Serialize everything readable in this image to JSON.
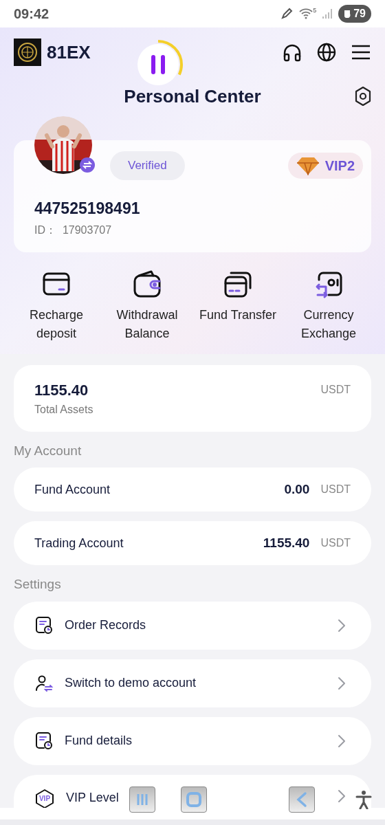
{
  "status_bar": {
    "time": "09:42",
    "wifi_badge": "5",
    "battery": "79"
  },
  "header": {
    "brand": "81EX",
    "title": "Personal Center"
  },
  "media_overlay": {
    "playing": true,
    "level": 0.32
  },
  "profile": {
    "verified": "Verified",
    "vip": "VIP2",
    "username": "447525198491",
    "id": "ID：  17903707"
  },
  "actions": [
    {
      "kind": "recharge",
      "label": "Recharge deposit"
    },
    {
      "kind": "withdraw",
      "label": "Withdrawal Balance"
    },
    {
      "kind": "transfer",
      "label": "Fund Transfer"
    },
    {
      "kind": "exchange",
      "label": "Currency Exchange"
    }
  ],
  "total_assets": {
    "amount": "1155.40",
    "label": "Total Assets",
    "unit": "USDT"
  },
  "my_account": {
    "title": "My Account",
    "rows": [
      {
        "name": "Fund Account",
        "amount": "0.00",
        "unit": "USDT"
      },
      {
        "name": "Trading Account",
        "amount": "1155.40",
        "unit": "USDT"
      }
    ]
  },
  "settings": {
    "title": "Settings",
    "items": [
      {
        "kind": "records",
        "label": "Order Records"
      },
      {
        "kind": "switch",
        "label": "Switch to demo account"
      },
      {
        "kind": "records",
        "label": "Fund details"
      },
      {
        "kind": "vip",
        "label": "VIP Level",
        "badge": "VIP"
      }
    ]
  }
}
